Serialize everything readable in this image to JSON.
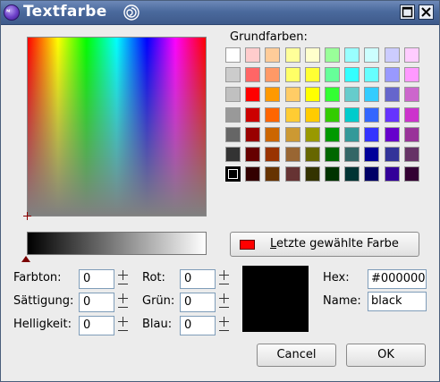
{
  "window": {
    "title": "Textfarbe"
  },
  "basic_colors": {
    "label": "Grundfarben:",
    "rows": [
      [
        "#ffffff",
        "#ffcccc",
        "#ffcc99",
        "#ffff99",
        "#ffffcc",
        "#99ff99",
        "#99ffff",
        "#ccffff",
        "#ccccff",
        "#ffccff"
      ],
      [
        "#cccccc",
        "#ff6666",
        "#ff9966",
        "#ffff66",
        "#ffff33",
        "#66ff99",
        "#33ffff",
        "#66ffff",
        "#9999ff",
        "#ff99ff"
      ],
      [
        "#c0c0c0",
        "#ff0000",
        "#ff9900",
        "#ffcc66",
        "#ffff00",
        "#33ff33",
        "#66cccc",
        "#33ccff",
        "#6666cc",
        "#cc66cc"
      ],
      [
        "#999999",
        "#cc0000",
        "#ff6600",
        "#ffcc33",
        "#ffcc00",
        "#33cc00",
        "#00cccc",
        "#3366ff",
        "#6633ff",
        "#cc33cc"
      ],
      [
        "#666666",
        "#990000",
        "#cc6600",
        "#cc9933",
        "#999900",
        "#009900",
        "#339999",
        "#3333ff",
        "#6600cc",
        "#993399"
      ],
      [
        "#333333",
        "#660000",
        "#993300",
        "#996633",
        "#666600",
        "#006600",
        "#336666",
        "#000099",
        "#333399",
        "#663366"
      ],
      [
        "#000000",
        "#330000",
        "#663300",
        "#663333",
        "#333300",
        "#003300",
        "#003333",
        "#000066",
        "#330099",
        "#330033"
      ]
    ],
    "selected": "#000000"
  },
  "last_color": {
    "label_mnemonic": "L",
    "label_rest": "etzte gewählte Farbe",
    "color": "#ff0000"
  },
  "fields": {
    "hue_label": "Farbton:",
    "hue": "0",
    "sat_label": "Sättigung:",
    "sat": "0",
    "val_label": "Helligkeit:",
    "val": "0",
    "red_label": "Rot:",
    "red": "0",
    "green_label": "Grün:",
    "green": "0",
    "blue_label": "Blau:",
    "blue": "0"
  },
  "hex_label": "Hex:",
  "hex": "#000000",
  "name_label": "Name:",
  "name": "black",
  "preview_color": "#000000",
  "buttons": {
    "cancel": "Cancel",
    "ok": "OK"
  }
}
